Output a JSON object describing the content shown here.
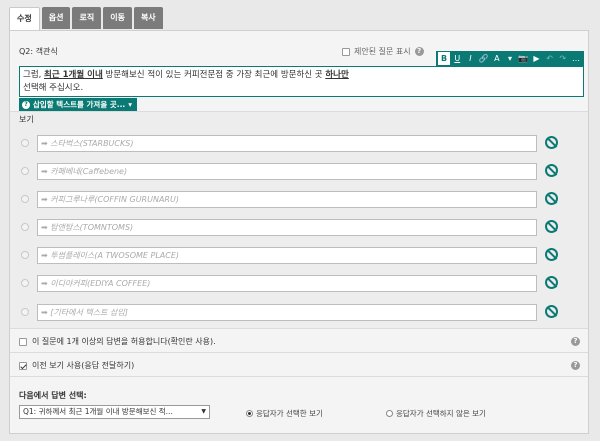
{
  "tabs": [
    "수정",
    "옵션",
    "로직",
    "이동",
    "복사"
  ],
  "question": {
    "id_label": "Q2: 객관식",
    "hidden_label": "제안된 질문 표시",
    "text_prefix": "그럼, ",
    "text_bold1": "최근 1개월 이내",
    "text_mid": " 방문해보신 적이 있는 커피전문점 중 가장 최근에 방문하신 곳 ",
    "text_bold2": "하나만",
    "text_line2": "선택해 주십시오."
  },
  "toolbar": [
    "B",
    "U",
    "I",
    "🔗",
    "A",
    "▾",
    "📷",
    "▶",
    "↶",
    "↷",
    "…"
  ],
  "insert_button": "삽입할 텍스트를 가져올 곳...",
  "options_title": "보기",
  "options": [
    "➡ 스타벅스(STARBUCKS)",
    "➡ 카페베네(Caffebene)",
    "➡ 커피그루나루(COFFIN GURUNARU)",
    "➡ 탐앤탐스(TOMNTOMS)",
    "➡ 투썸플레이스(A TWOSOME PLACE)",
    "➡ 이디야커피(EDIYA COFFEE)",
    "➡ [기타에서 텍스트 삽입]"
  ],
  "settings": {
    "multi_answer": "이 질문에 1개 이상의 답변을 허용합니다(확인란 사용).",
    "prev_options": "이전 보기 사용(응답 전달하기)"
  },
  "next": {
    "title": "다음에서 답변 선택:",
    "select_value": "Q1: 귀하께서 최근 1개월 이내 방문해보신 적...",
    "radio1": "응답자가 선택한 보기",
    "radio2": "응답자가 선택하지 않은 보기"
  },
  "colors": {
    "accent": "#0b7a74",
    "tab_inactive": "#7b7b7b"
  }
}
